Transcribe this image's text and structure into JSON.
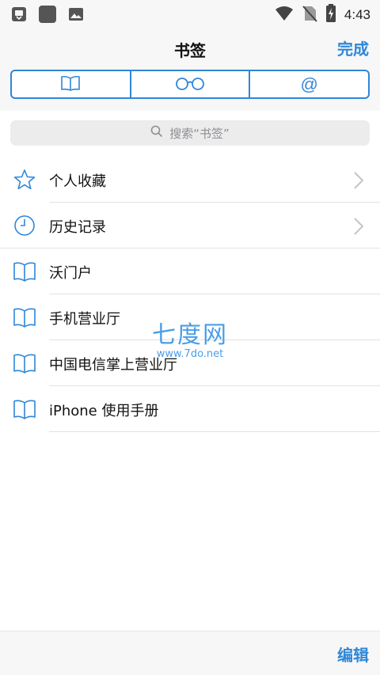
{
  "status_bar": {
    "time": "4:43",
    "left_icons": [
      "notification-icon",
      "app-icon",
      "gallery-icon"
    ],
    "right_icons": [
      "wifi-icon",
      "no-sim-icon",
      "battery-charging-icon"
    ]
  },
  "header": {
    "title": "书签",
    "done_label": "完成"
  },
  "segments": [
    {
      "icon": "book-icon"
    },
    {
      "icon": "glasses-icon"
    },
    {
      "icon": "at-icon",
      "label": "@"
    }
  ],
  "search": {
    "placeholder": "搜索“书签”"
  },
  "list": [
    {
      "label": "个人收藏",
      "icon": "star-icon",
      "chevron": true
    },
    {
      "label": "历史记录",
      "icon": "clock-icon",
      "chevron": true
    },
    {
      "label": "沃门户",
      "icon": "book-icon",
      "chevron": false
    },
    {
      "label": "手机营业厅",
      "icon": "book-icon",
      "chevron": false
    },
    {
      "label": "中国电信掌上营业厅",
      "icon": "book-icon",
      "chevron": false
    },
    {
      "label": "iPhone 使用手册",
      "icon": "book-icon",
      "chevron": false
    }
  ],
  "watermark": {
    "main": "七度网",
    "sub": "www.7do.net"
  },
  "bottom_bar": {
    "edit_label": "编辑"
  },
  "colors": {
    "accent": "#2f87d8",
    "bar_background": "#f7f7f7",
    "separator": "#e2e2e2"
  }
}
